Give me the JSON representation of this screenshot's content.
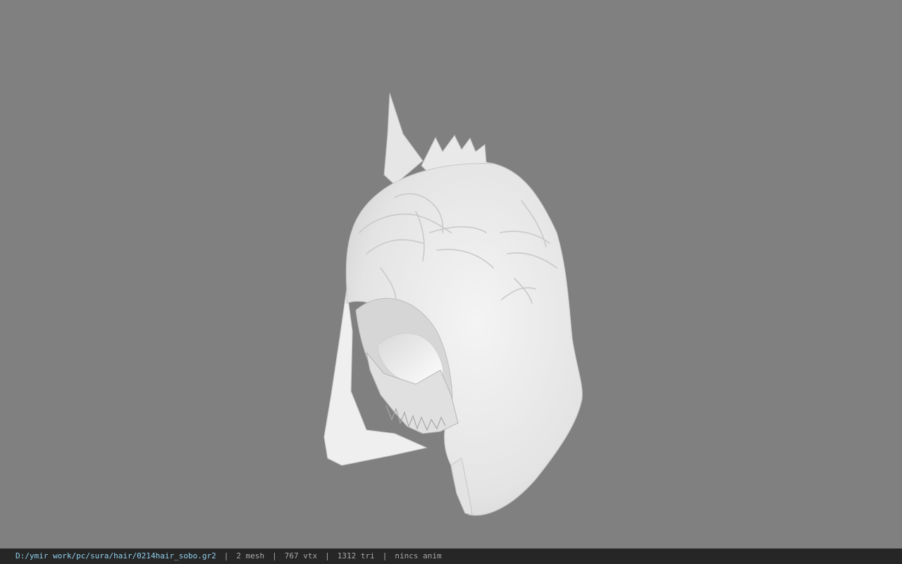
{
  "viewer": {
    "background_color": "#808080",
    "model_color": "#ebebeb",
    "model_description_icon": "hooded-helmet-model"
  },
  "statusbar": {
    "file_path": "D:/ymir work/pc/sura/hair/0214hair_sobo.gr2",
    "separator": "|",
    "mesh_count": "2 mesh",
    "vertex_count": "767 vtx",
    "triangle_count": "1312 tri",
    "anim_status": "nincs anim",
    "path_color": "#8fd0ee",
    "background_color": "#262626"
  }
}
